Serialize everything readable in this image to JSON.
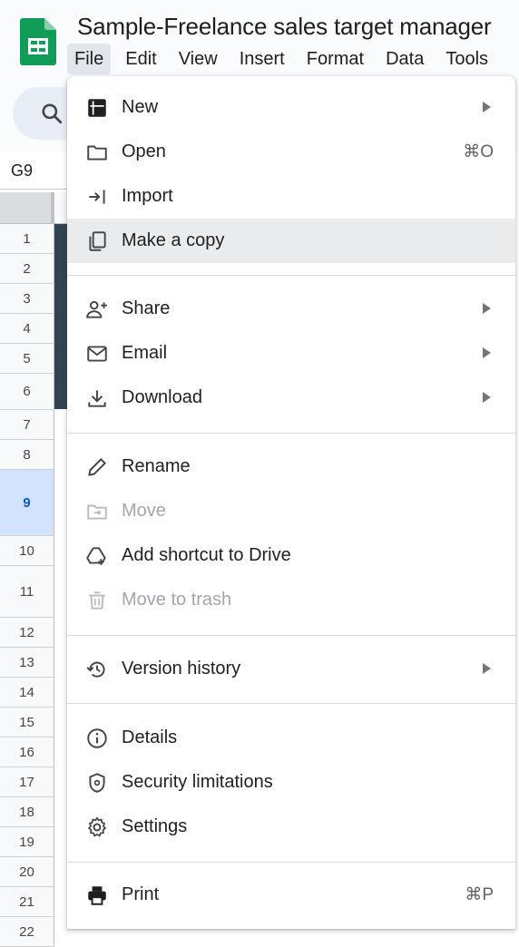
{
  "app": {
    "doc_title": "Sample-Freelance sales target manager",
    "name_box": "G9",
    "menubar": [
      "File",
      "Edit",
      "View",
      "Insert",
      "Format",
      "Data",
      "Tools"
    ]
  },
  "rows": [
    "1",
    "2",
    "3",
    "4",
    "5",
    "6",
    "7",
    "8",
    "9",
    "10",
    "11",
    "12",
    "13",
    "14",
    "15",
    "16",
    "17",
    "18",
    "19",
    "20",
    "21",
    "22"
  ],
  "selected_row": "9",
  "file_menu": {
    "items": [
      {
        "label": "New",
        "icon": "new-sheet-icon",
        "submenu": true
      },
      {
        "label": "Open",
        "icon": "folder-icon",
        "shortcut": "⌘O"
      },
      {
        "label": "Import",
        "icon": "import-icon"
      },
      {
        "label": "Make a copy",
        "icon": "copy-icon",
        "highlighted": true
      },
      {
        "label": "Share",
        "icon": "share-person-icon",
        "submenu": true
      },
      {
        "label": "Email",
        "icon": "email-icon",
        "submenu": true
      },
      {
        "label": "Download",
        "icon": "download-icon",
        "submenu": true
      },
      {
        "label": "Rename",
        "icon": "pencil-icon"
      },
      {
        "label": "Move",
        "icon": "move-folder-icon",
        "disabled": true
      },
      {
        "label": "Add shortcut to Drive",
        "icon": "drive-shortcut-icon"
      },
      {
        "label": "Move to trash",
        "icon": "trash-icon",
        "disabled": true
      },
      {
        "label": "Version history",
        "icon": "history-icon",
        "submenu": true
      },
      {
        "label": "Details",
        "icon": "info-icon"
      },
      {
        "label": "Security limitations",
        "icon": "shield-icon"
      },
      {
        "label": "Settings",
        "icon": "gear-icon"
      },
      {
        "label": "Print",
        "icon": "printer-icon",
        "shortcut": "⌘P"
      }
    ]
  },
  "colors": {
    "sheets_green": "#0f9d58",
    "menu_hover": "#eaebed",
    "selected_row_bg": "#d3e3fd",
    "disabled_text": "#a3a6aa"
  }
}
